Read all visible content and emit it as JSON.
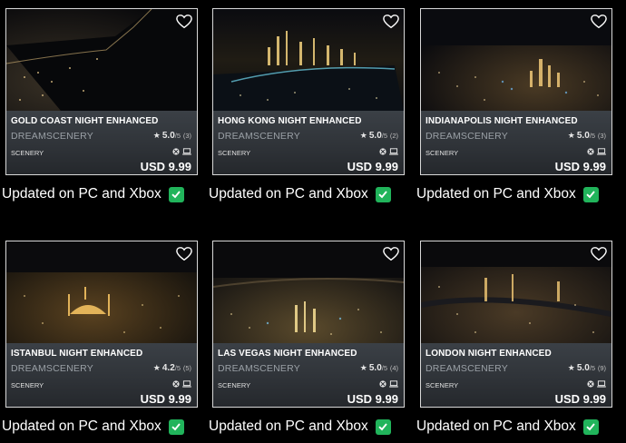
{
  "products": [
    {
      "title": "GOLD COAST NIGHT ENHANCED",
      "publisher": "DREAMSCENERY",
      "rating": "5.0",
      "rating_max": "/5",
      "rating_count": "(3)",
      "category": "SCENERY",
      "price": "USD 9.99",
      "status": "Updated on PC and Xbox",
      "platforms": [
        "xbox-icon",
        "pc-icon"
      ]
    },
    {
      "title": "HONG KONG NIGHT ENHANCED",
      "publisher": "DREAMSCENERY",
      "rating": "5.0",
      "rating_max": "/5",
      "rating_count": "(2)",
      "category": "SCENERY",
      "price": "USD 9.99",
      "status": "Updated on PC and Xbox",
      "platforms": [
        "xbox-icon",
        "pc-icon"
      ]
    },
    {
      "title": "INDIANAPOLIS NIGHT ENHANCED",
      "publisher": "DREAMSCENERY",
      "rating": "5.0",
      "rating_max": "/5",
      "rating_count": "(3)",
      "category": "SCENERY",
      "price": "USD 9.99",
      "status": "Updated on PC and Xbox",
      "platforms": [
        "xbox-icon",
        "pc-icon"
      ]
    },
    {
      "title": "ISTANBUL NIGHT ENHANCED",
      "publisher": "DREAMSCENERY",
      "rating": "4.2",
      "rating_max": "/5",
      "rating_count": "(5)",
      "category": "SCENERY",
      "price": "USD 9.99",
      "status": "Updated on PC and Xbox",
      "platforms": [
        "xbox-icon",
        "pc-icon"
      ]
    },
    {
      "title": "LAS VEGAS NIGHT ENHANCED",
      "publisher": "DREAMSCENERY",
      "rating": "5.0",
      "rating_max": "/5",
      "rating_count": "(4)",
      "category": "SCENERY",
      "price": "USD 9.99",
      "status": "Updated on PC and Xbox",
      "platforms": [
        "xbox-icon",
        "pc-icon"
      ]
    },
    {
      "title": "LONDON NIGHT ENHANCED",
      "publisher": "DREAMSCENERY",
      "rating": "5.0",
      "rating_max": "/5",
      "rating_count": "(9)",
      "category": "SCENERY",
      "price": "USD 9.99",
      "status": "Updated on PC and Xbox",
      "platforms": [
        "xbox-icon",
        "pc-icon"
      ]
    }
  ],
  "colors": {
    "card_bg": "#2f3338",
    "status_check": "#21b45b",
    "page_bg": "#000000"
  }
}
